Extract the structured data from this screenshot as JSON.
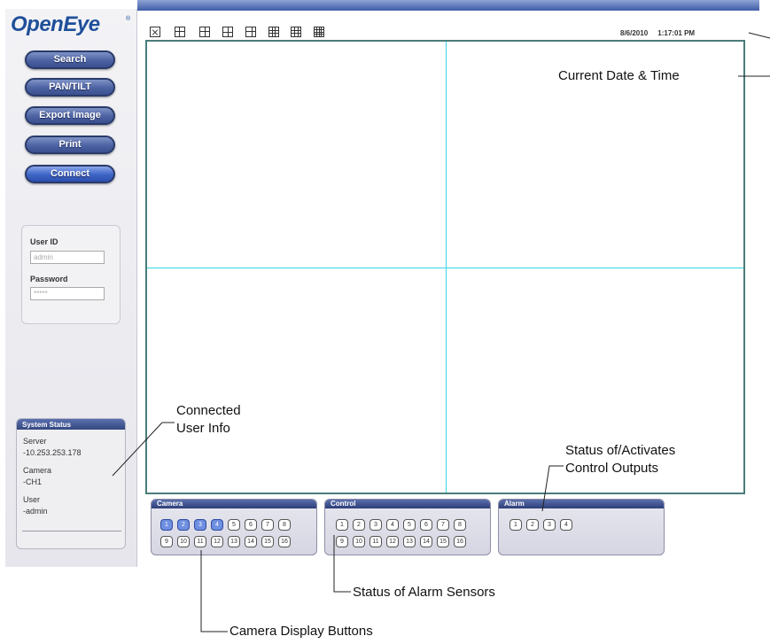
{
  "brand": {
    "name": "OpenEye",
    "mark": "®"
  },
  "nav": [
    {
      "id": "search",
      "label": "Search"
    },
    {
      "id": "pantilt",
      "label": "PAN/TILT"
    },
    {
      "id": "export",
      "label": "Export Image"
    },
    {
      "id": "print",
      "label": "Print"
    },
    {
      "id": "connect",
      "label": "Connect"
    }
  ],
  "login": {
    "user_label": "User ID",
    "user_value": "admin",
    "password_label": "Password",
    "password_value": "*****"
  },
  "system_status": {
    "title": "System Status",
    "server_label": "Server",
    "server_value": "-10.253.253.178",
    "camera_label": "Camera",
    "camera_value": "-CH1",
    "user_label": "User",
    "user_value": "-admin"
  },
  "datetime": {
    "date": "8/6/2010",
    "time": "1:17:01 PM"
  },
  "panels": {
    "camera": {
      "title": "Camera",
      "buttons": [
        "1",
        "2",
        "3",
        "4",
        "5",
        "6",
        "7",
        "8",
        "9",
        "10",
        "11",
        "12",
        "13",
        "14",
        "15",
        "16"
      ],
      "active": [
        "1",
        "2",
        "3",
        "4"
      ]
    },
    "control": {
      "title": "Control",
      "buttons": [
        "1",
        "2",
        "3",
        "4",
        "5",
        "6",
        "7",
        "8",
        "9",
        "10",
        "11",
        "12",
        "13",
        "14",
        "15",
        "16"
      ]
    },
    "alarm": {
      "title": "Alarm",
      "buttons": [
        "1",
        "2",
        "3",
        "4"
      ]
    }
  },
  "annotations": {
    "datetime": "Current Date & Time",
    "user_info_1": "Connected",
    "user_info_2": "User Info",
    "outputs_1": "Status of/Activates",
    "outputs_2": "Control Outputs",
    "alarm": "Status of Alarm Sensors",
    "camera": "Camera Display Buttons"
  },
  "colors": {
    "accent": "#3e5ca6",
    "grid_line": "#38d7e3",
    "grid_border": "#4a7c7a"
  }
}
